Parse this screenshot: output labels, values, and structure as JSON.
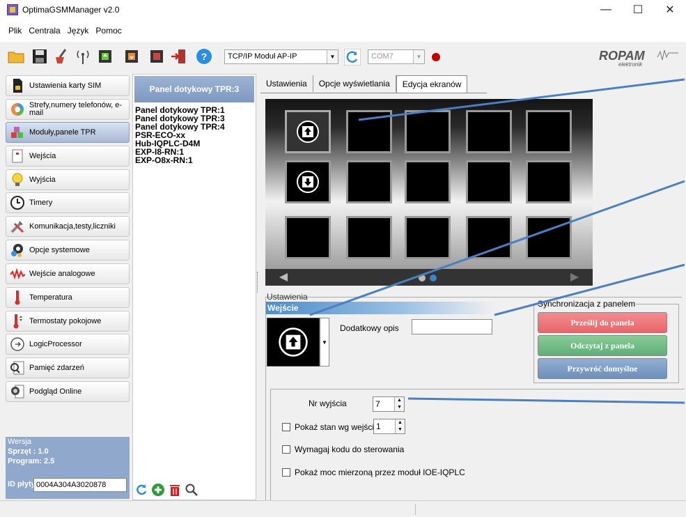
{
  "window": {
    "title": "OptimaGSMManager v2.0",
    "minimize": "—",
    "maximize": "☐",
    "close": "✕"
  },
  "menu": [
    "Plik",
    "Centrala",
    "Język",
    "Pomoc"
  ],
  "toolbar": {
    "connection": "TCP/IP Moduł AP-IP",
    "port": "COM7",
    "help": "?",
    "icons": [
      "folder-icon",
      "save-icon",
      "broom-icon",
      "wireless-icon",
      "chip-upload-icon",
      "chip-download-icon",
      "exit-icon",
      "help-icon"
    ],
    "refresh_icon": "refresh-icon",
    "status_led_color": "#c00000",
    "logo": "ROPAM elektronik"
  },
  "nav": {
    "items": [
      {
        "label": "Ustawienia karty SIM",
        "icon": "sim-card-icon"
      },
      {
        "label": "Strefy,numery telefonów, e-mail",
        "icon": "zones-pie-icon"
      },
      {
        "label": "Moduły,panele TPR",
        "icon": "modules-cubes-icon"
      },
      {
        "label": "Wejścia",
        "icon": "inputs-icon"
      },
      {
        "label": "Wyjścia",
        "icon": "outputs-bulb-icon"
      },
      {
        "label": "Timery",
        "icon": "clock-icon"
      },
      {
        "label": "Komunikacja,testy,liczniki",
        "icon": "tools-icon"
      },
      {
        "label": "Opcje systemowe",
        "icon": "gears-icon"
      },
      {
        "label": "Wejście analogowe",
        "icon": "analog-wave-icon"
      },
      {
        "label": "Temperatura",
        "icon": "thermometer-icon"
      },
      {
        "label": "Termostaty pokojowe",
        "icon": "thermostat-icon"
      },
      {
        "label": "LogicProcessor",
        "icon": "logic-processor-icon"
      },
      {
        "label": "Pamięć zdarzeń",
        "icon": "event-log-icon"
      },
      {
        "label": "Podgląd Online",
        "icon": "online-preview-icon"
      }
    ],
    "active_index": 2
  },
  "version": {
    "title": "Wersja",
    "hardware": "Sprzęt : 1.0",
    "program": "Program: 2.5",
    "board_id_label": "ID płyty",
    "board_id": "0004A304A3020878"
  },
  "modules": {
    "header": "Panel dotykowy TPR:3",
    "items": [
      "Panel dotykowy TPR:1",
      "Panel dotykowy TPR:3",
      "Panel dotykowy TPR:4",
      "PSR-ECO-xx",
      "Hub-IQPLC-D4M",
      "EXP-I8-RN:1",
      "EXP-O8x-RN:1"
    ],
    "tools": [
      "refresh-icon",
      "add-icon",
      "delete-icon",
      "search-icon"
    ]
  },
  "tabs": [
    "Ustawienia",
    "Opcje wyświetlania",
    "Edycja ekranów"
  ],
  "active_tab": 2,
  "settings": {
    "group_label": "Ustawienia",
    "section_title": "Wejście",
    "desc_label": "Dodatkowy opis",
    "desc_value": "",
    "sync_title": "Synchronizacja z panelem",
    "sync_buttons": [
      {
        "label": "Prześlij do panela",
        "color": "#e8656a"
      },
      {
        "label": "Odczytaj z panela",
        "color": "#5fae78"
      },
      {
        "label": "Przywróć domyślne",
        "color": "#6d8fbb"
      }
    ],
    "output_label": "Nr wyjścia",
    "output_value": "7",
    "show_state_label": "Pokaż stan wg wejścia",
    "show_state_value": "1",
    "show_state_checked": false,
    "require_code_label": "Wymagaj kodu do sterowania",
    "require_code_checked": false,
    "show_power_label": "Pokaż moc mierzoną przez moduł IOE-IQPLC",
    "show_power_checked": false
  }
}
